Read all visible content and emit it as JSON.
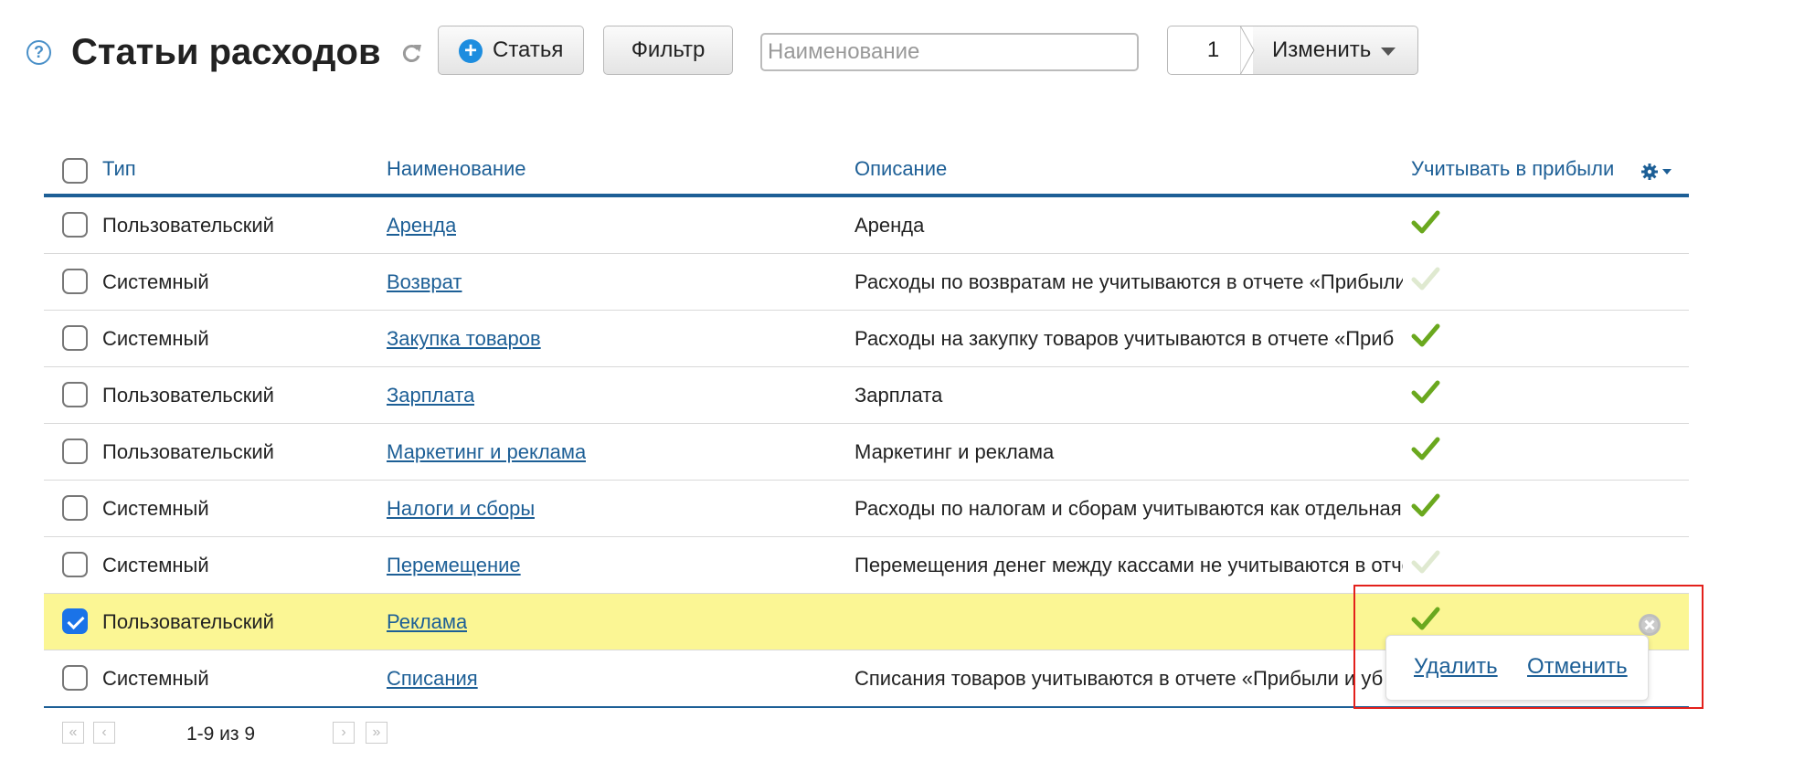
{
  "toolbar": {
    "help_icon": "question-icon",
    "title": "Статьи расходов",
    "add_label": "Статья",
    "filter_label": "Фильтр",
    "search_placeholder": "Наименование",
    "search_value": "",
    "selected_count": "1",
    "change_label": "Изменить"
  },
  "table": {
    "headers": {
      "type": "Тип",
      "name": "Наименование",
      "description": "Описание",
      "profit": "Учитывать в прибыли"
    },
    "rows": [
      {
        "type": "Пользовательский",
        "name": "Аренда",
        "description": "Аренда",
        "profit": "active",
        "checked": false
      },
      {
        "type": "Системный",
        "name": "Возврат",
        "description": "Расходы по возвратам не учитываются в отчете «Прибыли",
        "profit": "inactive",
        "checked": false
      },
      {
        "type": "Системный",
        "name": "Закупка товаров",
        "description": "Расходы на закупку товаров учитываются в отчете «Приб",
        "profit": "active",
        "checked": false
      },
      {
        "type": "Пользовательский",
        "name": "Зарплата",
        "description": "Зарплата",
        "profit": "active",
        "checked": false
      },
      {
        "type": "Пользовательский",
        "name": "Маркетинг и реклама",
        "description": "Маркетинг и реклама",
        "profit": "active",
        "checked": false
      },
      {
        "type": "Системный",
        "name": "Налоги и сборы",
        "description": "Расходы по налогам и сборам учитываются как отдельная",
        "profit": "active",
        "checked": false
      },
      {
        "type": "Системный",
        "name": "Перемещение",
        "description": "Перемещения денег между кассами не учитываются в отче",
        "profit": "inactive",
        "checked": false
      },
      {
        "type": "Пользовательский",
        "name": "Реклама",
        "description": "",
        "profit": "active",
        "checked": true
      },
      {
        "type": "Системный",
        "name": "Списания",
        "description": "Списания товаров учитываются в отчете «Прибыли и уб",
        "profit": "",
        "checked": false
      }
    ]
  },
  "popup": {
    "delete_label": "Удалить",
    "cancel_label": "Отменить"
  },
  "pagination": {
    "info": "1-9 из 9",
    "first": "«",
    "prev": "‹",
    "next": "›",
    "last": "»"
  },
  "colors": {
    "link": "#1d5f96",
    "check_active": "#6aa81e",
    "check_inactive": "#dfe9d0",
    "selected_row": "#fbf694",
    "highlight": "#e3201b"
  }
}
